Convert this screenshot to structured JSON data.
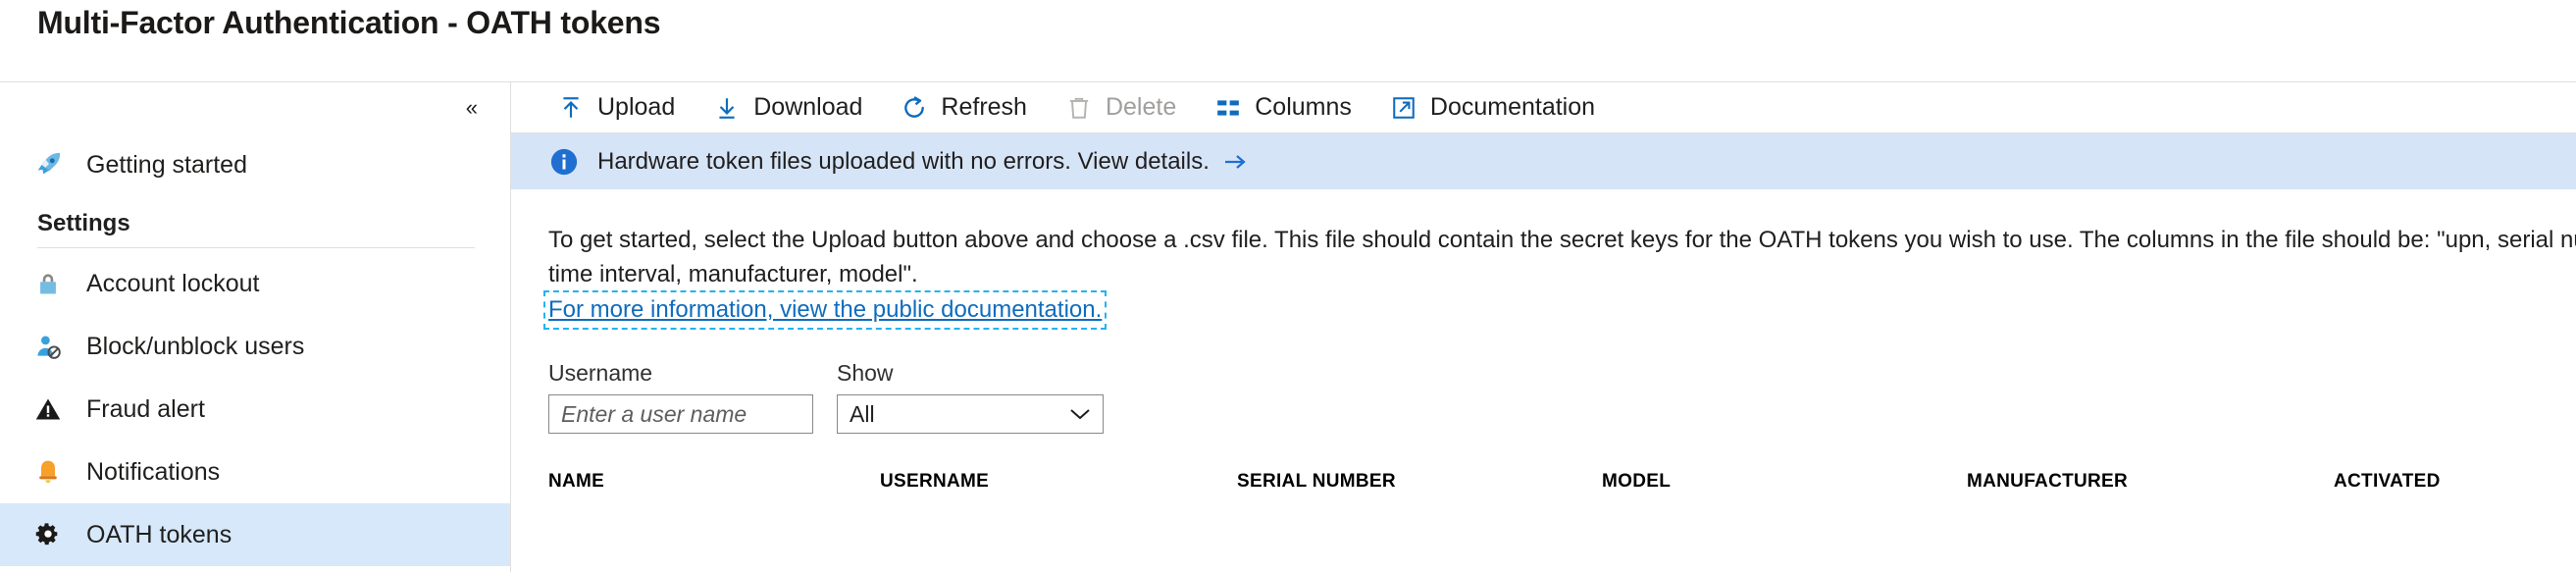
{
  "header": {
    "title": "Multi-Factor Authentication - OATH tokens"
  },
  "sidebar": {
    "collapse_label": "«",
    "collapse_icon": "chevron-double-left-icon",
    "top_items": [
      {
        "label": "Getting started",
        "icon": "rocket-icon",
        "selected": false
      }
    ],
    "section_label": "Settings",
    "items": [
      {
        "label": "Account lockout",
        "icon": "lock-icon",
        "selected": false
      },
      {
        "label": "Block/unblock users",
        "icon": "user-block-icon",
        "selected": false
      },
      {
        "label": "Fraud alert",
        "icon": "warning-triangle-icon",
        "selected": false
      },
      {
        "label": "Notifications",
        "icon": "bell-icon",
        "selected": false
      },
      {
        "label": "OATH tokens",
        "icon": "gear-icon",
        "selected": true
      }
    ]
  },
  "toolbar": {
    "items": [
      {
        "label": "Upload",
        "icon": "upload-arrow-icon",
        "disabled": false
      },
      {
        "label": "Download",
        "icon": "download-arrow-icon",
        "disabled": false
      },
      {
        "label": "Refresh",
        "icon": "refresh-circular-icon",
        "disabled": false
      },
      {
        "label": "Delete",
        "icon": "trash-can-icon",
        "disabled": true
      },
      {
        "label": "Columns",
        "icon": "columns-grid-icon",
        "disabled": false
      },
      {
        "label": "Documentation",
        "icon": "external-link-icon",
        "disabled": false
      }
    ]
  },
  "message_bar": {
    "icon": "info-circle-icon",
    "text": "Hardware token files uploaded with no errors. View details.",
    "arrow_icon": "arrow-right-icon",
    "background": "#d6e4f7"
  },
  "description": {
    "line1": "To get started, select the Upload button above and choose a .csv file. This file should contain the secret keys for the OATH tokens you wish to use. The columns in the file should be: \"upn, serial nu",
    "line2": "time interval, manufacturer, model\".",
    "link": "For more information, view the public documentation."
  },
  "filters": {
    "username": {
      "label": "Username",
      "placeholder": "Enter a user name",
      "value": ""
    },
    "show": {
      "label": "Show",
      "value": "All",
      "caret_icon": "chevron-down-icon"
    }
  },
  "table": {
    "columns": [
      "NAME",
      "USERNAME",
      "SERIAL NUMBER",
      "MODEL",
      "MANUFACTURER",
      "ACTIVATED"
    ]
  },
  "colors": {
    "accent": "#0f6cbd",
    "selected_row": "#d6e8f9",
    "info_bar": "#d6e4f7",
    "focus_ring": "#22b3ef"
  }
}
